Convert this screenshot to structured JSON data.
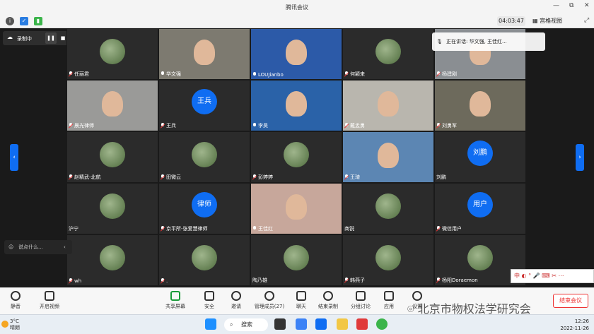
{
  "window": {
    "title": "腾讯会议",
    "min": "—",
    "max": "⧉",
    "close": "✕"
  },
  "infobar": {
    "timer": "04:03:47",
    "gallery": "宫格视图"
  },
  "recording": {
    "label": "录制中",
    "pause": "❚❚",
    "stop": "■"
  },
  "speaker": {
    "text": "正在讲话: 华文强, 王佳红..."
  },
  "arrows": {
    "left": "‹",
    "right": "›"
  },
  "chat": {
    "placeholder": "说点什么...",
    "collapse": "‹"
  },
  "participants": [
    {
      "name": "任丽君",
      "type": "img",
      "color": "#3b3b3b",
      "mic": "off"
    },
    {
      "name": "华文强",
      "type": "video",
      "color": "#7d7a70",
      "mic": "on"
    },
    {
      "name": "LOUJianbo",
      "type": "video",
      "color": "#2c5aa8",
      "mic": "on"
    },
    {
      "name": "何颖来",
      "type": "img",
      "color": "#3b3b3b",
      "mic": "off"
    },
    {
      "name": "杨建刚",
      "type": "video",
      "color": "#8a8e92",
      "mic": "off"
    },
    {
      "name": "晨光律师",
      "type": "video",
      "color": "#9a9a98",
      "mic": "off"
    },
    {
      "name": "王兵",
      "type": "text",
      "avatar": "王兵",
      "mic": "off"
    },
    {
      "name": "李昊",
      "type": "video",
      "color": "#2a62a8",
      "mic": "on"
    },
    {
      "name": "戴孟勇",
      "type": "video",
      "color": "#b9b6ae",
      "mic": "off"
    },
    {
      "name": "刘勇军",
      "type": "video",
      "color": "#6d6a5c",
      "mic": "off"
    },
    {
      "name": "赵精武-北航",
      "type": "img",
      "color": "#3b3b3b",
      "mic": "off"
    },
    {
      "name": "田微云",
      "type": "img",
      "color": "#3b3b3b",
      "mic": "off"
    },
    {
      "name": "彭婷婷",
      "type": "img",
      "color": "#3b3b3b",
      "mic": "off"
    },
    {
      "name": "王琦",
      "type": "video",
      "color": "#5c86b3",
      "mic": "off"
    },
    {
      "name": "刘鹏",
      "type": "text",
      "avatar": "刘鹏",
      "mic": "none"
    },
    {
      "name": "沪宁",
      "type": "img",
      "color": "#3b3b3b",
      "mic": "none"
    },
    {
      "name": "京平所-张爱慧律师",
      "type": "text",
      "avatar": "律师",
      "mic": "off"
    },
    {
      "name": "王佳红",
      "type": "video",
      "color": "#c7a79b",
      "mic": "on"
    },
    {
      "name": "商锐",
      "type": "img",
      "color": "#3b3b3b",
      "mic": "none"
    },
    {
      "name": "微信用户",
      "type": "text",
      "avatar": "用户",
      "mic": "off"
    },
    {
      "name": "wh",
      "type": "img",
      "color": "#3b3b3b",
      "mic": "off"
    },
    {
      "name": ".",
      "type": "img",
      "color": "#3b3b3b",
      "mic": "off"
    },
    {
      "name": "陶乃雄",
      "type": "img",
      "color": "#3b3b3b",
      "mic": "none"
    },
    {
      "name": "韩燕子",
      "type": "img",
      "color": "#3b3b3b",
      "mic": "off"
    },
    {
      "name": "杨阳Doraemon",
      "type": "img",
      "color": "#3b3b3b",
      "mic": "off"
    }
  ],
  "toolbar": {
    "mute": "静音",
    "video": "开启视频",
    "share": "共享屏幕",
    "security": "安全",
    "docs": "邀请",
    "manage": "管理成员(27)",
    "chat": "聊天",
    "record": "结束录制",
    "breakout": "分组讨论",
    "apps": "应用",
    "settings": "设置",
    "leave": "结束会议"
  },
  "watermark": "北京市物权法学研究会",
  "ime": "中 ◐ ° 🎤 ⌨ ✂ ⋯",
  "taskbar": {
    "temp": "3°C",
    "weather": "晴朗",
    "search": "搜索",
    "time": "12:26",
    "date": "2022-11-26"
  },
  "colors": {
    "accent": "#0f6df2",
    "leave": "#e33333"
  }
}
